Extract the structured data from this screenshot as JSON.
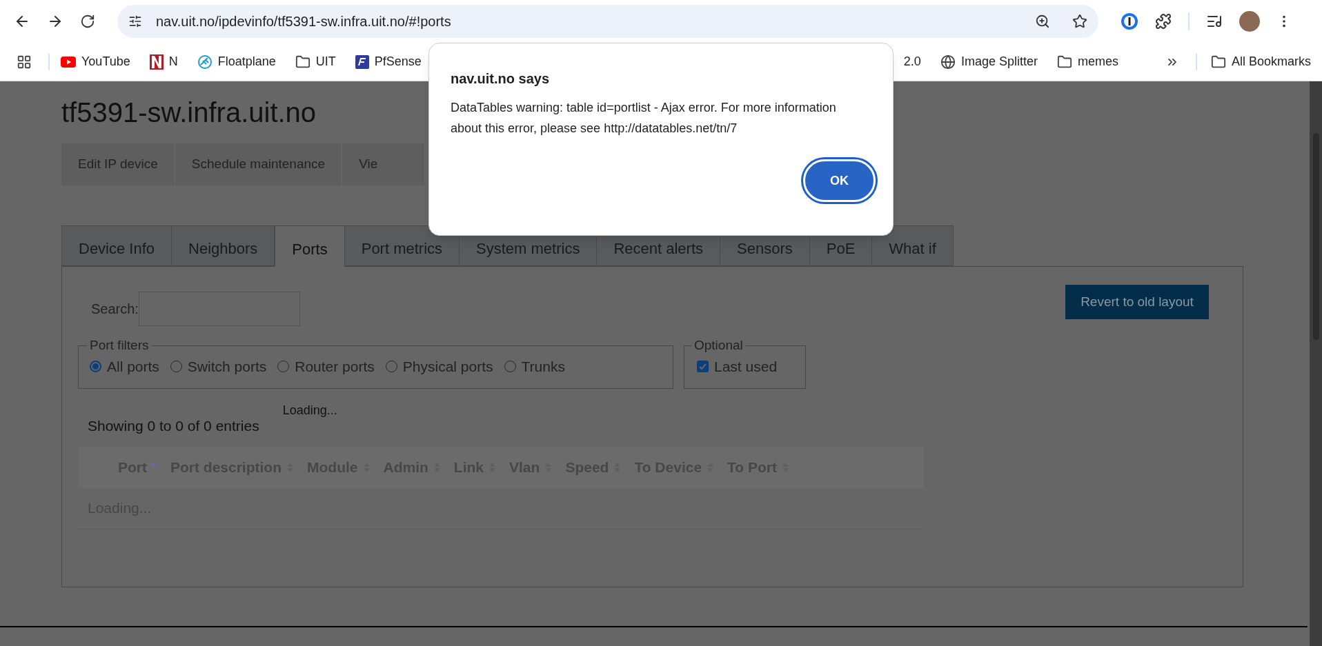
{
  "browser": {
    "address": "nav.uit.no/ipdevinfo/tf5391-sw.infra.uit.no/#!ports",
    "bookmarks": [
      {
        "label": "YouTube",
        "kind": "youtube"
      },
      {
        "label": "N",
        "kind": "n"
      },
      {
        "label": "Floatplane",
        "kind": "floatplane"
      },
      {
        "label": "UIT",
        "kind": "folder"
      },
      {
        "label": "PfSense",
        "kind": "pf"
      }
    ],
    "bookmarks_right": [
      {
        "label": "2.0",
        "kind": "partial"
      },
      {
        "label": "Image Splitter",
        "kind": "globe"
      },
      {
        "label": "memes",
        "kind": "folder"
      }
    ],
    "all_bookmarks": "All Bookmarks"
  },
  "page": {
    "title": "tf5391-sw.infra.uit.no",
    "actions": [
      "Edit IP device",
      "Schedule maintenance",
      "Vie"
    ],
    "tabs": [
      {
        "label": "Device Info",
        "selected": false
      },
      {
        "label": "Neighbors",
        "selected": false
      },
      {
        "label": "Ports",
        "selected": true
      },
      {
        "label": "Port metrics",
        "selected": false
      },
      {
        "label": "System metrics",
        "selected": false
      },
      {
        "label": "Recent alerts",
        "selected": false
      },
      {
        "label": "Sensors",
        "selected": false
      },
      {
        "label": "PoE",
        "selected": false
      },
      {
        "label": "What if",
        "selected": false
      }
    ],
    "search_label": "Search:",
    "revert_button": "Revert to old layout",
    "port_filters": {
      "legend": "Port filters",
      "options": [
        {
          "label": "All ports",
          "selected": true
        },
        {
          "label": "Switch ports",
          "selected": false
        },
        {
          "label": "Router ports",
          "selected": false
        },
        {
          "label": "Physical ports",
          "selected": false
        },
        {
          "label": "Trunks",
          "selected": false
        }
      ]
    },
    "optional": {
      "legend": "Optional",
      "options": [
        {
          "label": "Last used",
          "checked": true
        }
      ]
    },
    "info": "Showing 0 to 0 of 0 entries",
    "processing": "Loading...",
    "table": {
      "columns": [
        {
          "label": "Port",
          "sorted": true
        },
        {
          "label": "Port description",
          "sorted": false
        },
        {
          "label": "Module",
          "sorted": false
        },
        {
          "label": "Admin",
          "sorted": false
        },
        {
          "label": "Link",
          "sorted": false
        },
        {
          "label": "Vlan",
          "sorted": false
        },
        {
          "label": "Speed",
          "sorted": false
        },
        {
          "label": "To Device",
          "sorted": false
        },
        {
          "label": "To Port",
          "sorted": false
        }
      ],
      "empty_row": "Loading..."
    }
  },
  "dialog": {
    "title": "nav.uit.no says",
    "message": "DataTables warning: table id=portlist - Ajax error. For more information about this error, please see http://datatables.net/tn/7",
    "ok": "OK"
  }
}
